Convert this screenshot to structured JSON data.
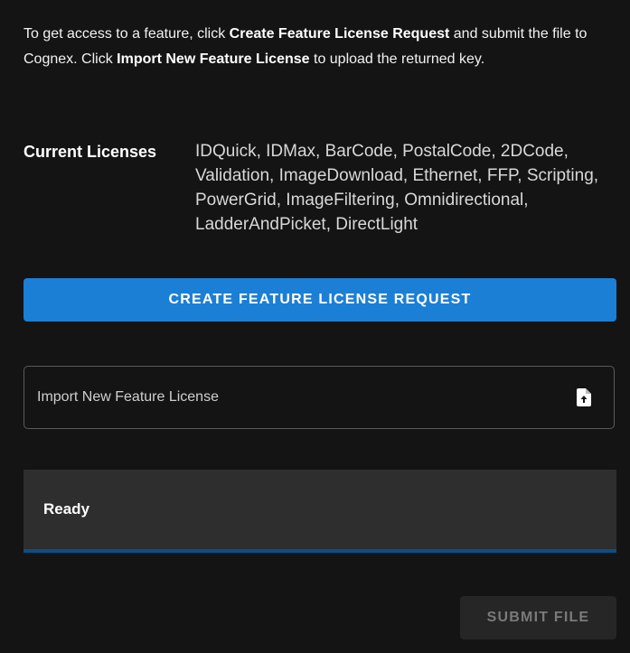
{
  "intro": {
    "part1": "To get access to a feature, click ",
    "bold1": "Create Feature License Request",
    "part2": " and submit the file to Cognex. Click ",
    "bold2": "Import New Feature License",
    "part3": " to upload the returned key."
  },
  "licenses": {
    "label": "Current Licenses",
    "value": "IDQuick, IDMax, BarCode, PostalCode, 2DCode, Validation, ImageDownload, Ethernet, FFP, Scripting, PowerGrid, ImageFiltering, Omnidirectional, LadderAndPicket, DirectLight"
  },
  "create_button": {
    "label": "CREATE FEATURE LICENSE REQUEST",
    "color": "#1b7fd6"
  },
  "import_field": {
    "label": "Import New Feature License",
    "icon": "file-upload-icon"
  },
  "status": {
    "text": "Ready",
    "accent": "#0b4f86"
  },
  "submit_button": {
    "label": "SUBMIT FILE",
    "disabled": true
  }
}
